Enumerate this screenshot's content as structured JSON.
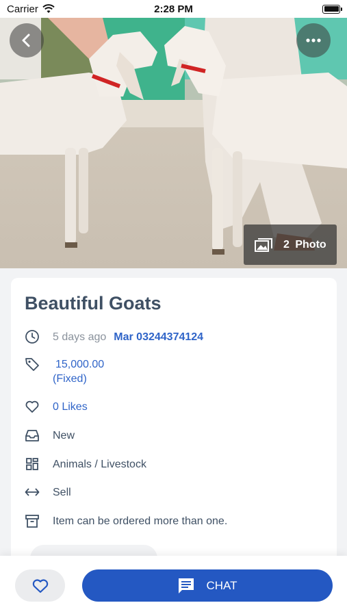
{
  "status_bar": {
    "carrier": "Carrier",
    "time": "2:28 PM"
  },
  "hero": {
    "photo_count": "2",
    "photo_label": "Photo"
  },
  "listing": {
    "title": "Beautiful Goats",
    "posted": "5 days ago",
    "seller": "Mar 03244374124",
    "price": "15,000.00",
    "price_type": "(Fixed)",
    "likes": "0 Likes",
    "condition": "New",
    "category": "Animals / Livestock",
    "deal_type": "Sell",
    "quantity_note": "Item can be ordered more than one."
  },
  "actions": {
    "chat_label": "CHAT"
  },
  "colors": {
    "accent": "#2458c2",
    "link": "#2f64c8",
    "text": "#3f5064"
  },
  "icons": [
    "wifi-icon",
    "battery-icon",
    "back-icon",
    "more-icon",
    "photos-icon",
    "clock-icon",
    "tag-icon",
    "heart-icon",
    "inbox-icon",
    "category-icon",
    "exchange-icon",
    "archive-icon",
    "chat-icon"
  ]
}
